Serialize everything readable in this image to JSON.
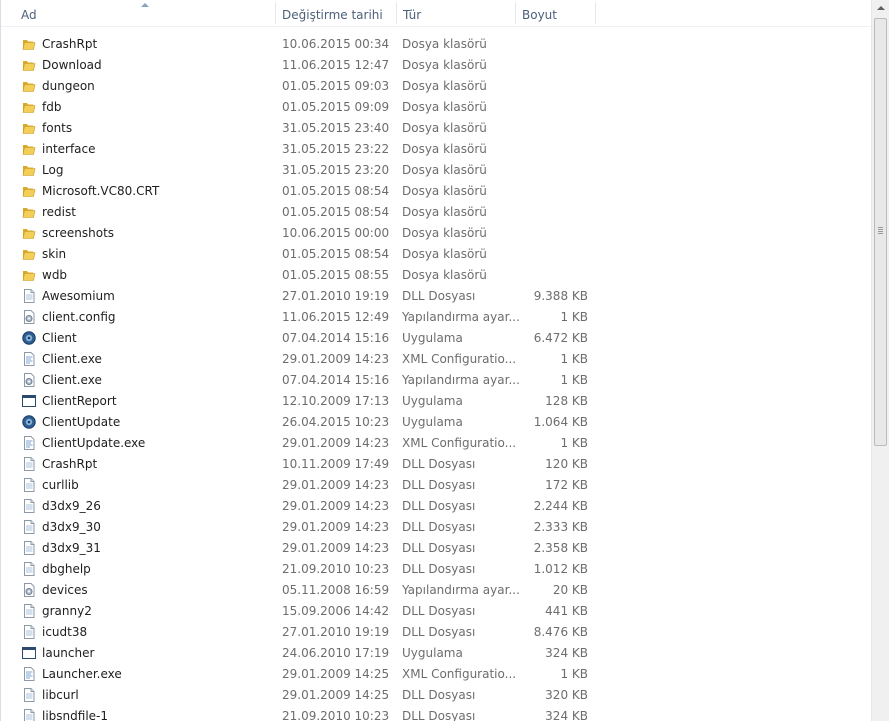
{
  "columns": {
    "name": "Ad",
    "date": "Değiştirme tarihi",
    "type": "Tür",
    "size": "Boyut"
  },
  "files": [
    {
      "name": "CrashRpt",
      "date": "10.06.2015 00:34",
      "type": "Dosya klasörü",
      "size": "",
      "icon": "folder-icon"
    },
    {
      "name": "Download",
      "date": "11.06.2015 12:47",
      "type": "Dosya klasörü",
      "size": "",
      "icon": "folder-icon"
    },
    {
      "name": "dungeon",
      "date": "01.05.2015 09:03",
      "type": "Dosya klasörü",
      "size": "",
      "icon": "folder-icon"
    },
    {
      "name": "fdb",
      "date": "01.05.2015 09:09",
      "type": "Dosya klasörü",
      "size": "",
      "icon": "folder-icon"
    },
    {
      "name": "fonts",
      "date": "31.05.2015 23:40",
      "type": "Dosya klasörü",
      "size": "",
      "icon": "folder-icon"
    },
    {
      "name": "interface",
      "date": "31.05.2015 23:22",
      "type": "Dosya klasörü",
      "size": "",
      "icon": "folder-icon"
    },
    {
      "name": "Log",
      "date": "31.05.2015 23:20",
      "type": "Dosya klasörü",
      "size": "",
      "icon": "folder-icon"
    },
    {
      "name": "Microsoft.VC80.CRT",
      "date": "01.05.2015 08:54",
      "type": "Dosya klasörü",
      "size": "",
      "icon": "folder-icon"
    },
    {
      "name": "redist",
      "date": "01.05.2015 08:54",
      "type": "Dosya klasörü",
      "size": "",
      "icon": "folder-icon"
    },
    {
      "name": "screenshots",
      "date": "10.06.2015 00:00",
      "type": "Dosya klasörü",
      "size": "",
      "icon": "folder-icon"
    },
    {
      "name": "skin",
      "date": "01.05.2015 08:54",
      "type": "Dosya klasörü",
      "size": "",
      "icon": "folder-icon"
    },
    {
      "name": "wdb",
      "date": "01.05.2015 08:55",
      "type": "Dosya klasörü",
      "size": "",
      "icon": "folder-icon"
    },
    {
      "name": "Awesomium",
      "date": "27.01.2010 19:19",
      "type": "DLL Dosyası",
      "size": "9.388 KB",
      "icon": "dll-file-icon"
    },
    {
      "name": "client.config",
      "date": "11.06.2015 12:49",
      "type": "Yapılandırma ayar...",
      "size": "1 KB",
      "icon": "config-file-icon"
    },
    {
      "name": "Client",
      "date": "07.04.2014 15:16",
      "type": "Uygulama",
      "size": "6.472 KB",
      "icon": "app-gear-icon"
    },
    {
      "name": "Client.exe",
      "date": "29.01.2009 14:23",
      "type": "XML Configuratio...",
      "size": "1 KB",
      "icon": "xml-file-icon"
    },
    {
      "name": "Client.exe",
      "date": "07.04.2014 15:16",
      "type": "Yapılandırma ayar...",
      "size": "1 KB",
      "icon": "config-file-icon"
    },
    {
      "name": "ClientReport",
      "date": "12.10.2009 17:13",
      "type": "Uygulama",
      "size": "128 KB",
      "icon": "app-window-icon"
    },
    {
      "name": "ClientUpdate",
      "date": "26.04.2015 10:23",
      "type": "Uygulama",
      "size": "1.064 KB",
      "icon": "app-gear-icon"
    },
    {
      "name": "ClientUpdate.exe",
      "date": "29.01.2009 14:23",
      "type": "XML Configuratio...",
      "size": "1 KB",
      "icon": "xml-file-icon"
    },
    {
      "name": "CrashRpt",
      "date": "10.11.2009 17:49",
      "type": "DLL Dosyası",
      "size": "120 KB",
      "icon": "dll-file-icon"
    },
    {
      "name": "curllib",
      "date": "29.01.2009 14:23",
      "type": "DLL Dosyası",
      "size": "172 KB",
      "icon": "dll-file-icon"
    },
    {
      "name": "d3dx9_26",
      "date": "29.01.2009 14:23",
      "type": "DLL Dosyası",
      "size": "2.244 KB",
      "icon": "dll-file-icon"
    },
    {
      "name": "d3dx9_30",
      "date": "29.01.2009 14:23",
      "type": "DLL Dosyası",
      "size": "2.333 KB",
      "icon": "dll-file-icon"
    },
    {
      "name": "d3dx9_31",
      "date": "29.01.2009 14:23",
      "type": "DLL Dosyası",
      "size": "2.358 KB",
      "icon": "dll-file-icon"
    },
    {
      "name": "dbghelp",
      "date": "21.09.2010 10:23",
      "type": "DLL Dosyası",
      "size": "1.012 KB",
      "icon": "dll-file-icon"
    },
    {
      "name": "devices",
      "date": "05.11.2008 16:59",
      "type": "Yapılandırma ayar...",
      "size": "20 KB",
      "icon": "config-file-icon"
    },
    {
      "name": "granny2",
      "date": "15.09.2006 14:42",
      "type": "DLL Dosyası",
      "size": "441 KB",
      "icon": "dll-file-icon"
    },
    {
      "name": "icudt38",
      "date": "27.01.2010 19:19",
      "type": "DLL Dosyası",
      "size": "8.476 KB",
      "icon": "dll-file-icon"
    },
    {
      "name": "launcher",
      "date": "24.06.2010 17:19",
      "type": "Uygulama",
      "size": "324 KB",
      "icon": "app-window-icon"
    },
    {
      "name": "Launcher.exe",
      "date": "29.01.2009 14:25",
      "type": "XML Configuratio...",
      "size": "1 KB",
      "icon": "xml-file-icon"
    },
    {
      "name": "libcurl",
      "date": "29.01.2009 14:25",
      "type": "DLL Dosyası",
      "size": "320 KB",
      "icon": "dll-file-icon"
    },
    {
      "name": "libsndfile-1",
      "date": "21.09.2010 10:23",
      "type": "DLL Dosyası",
      "size": "324 KB",
      "icon": "dll-file-icon"
    }
  ],
  "colors": {
    "header_text": "#4c607a",
    "folder": "#e8c04a",
    "secondary_text": "#6d6d6d"
  }
}
